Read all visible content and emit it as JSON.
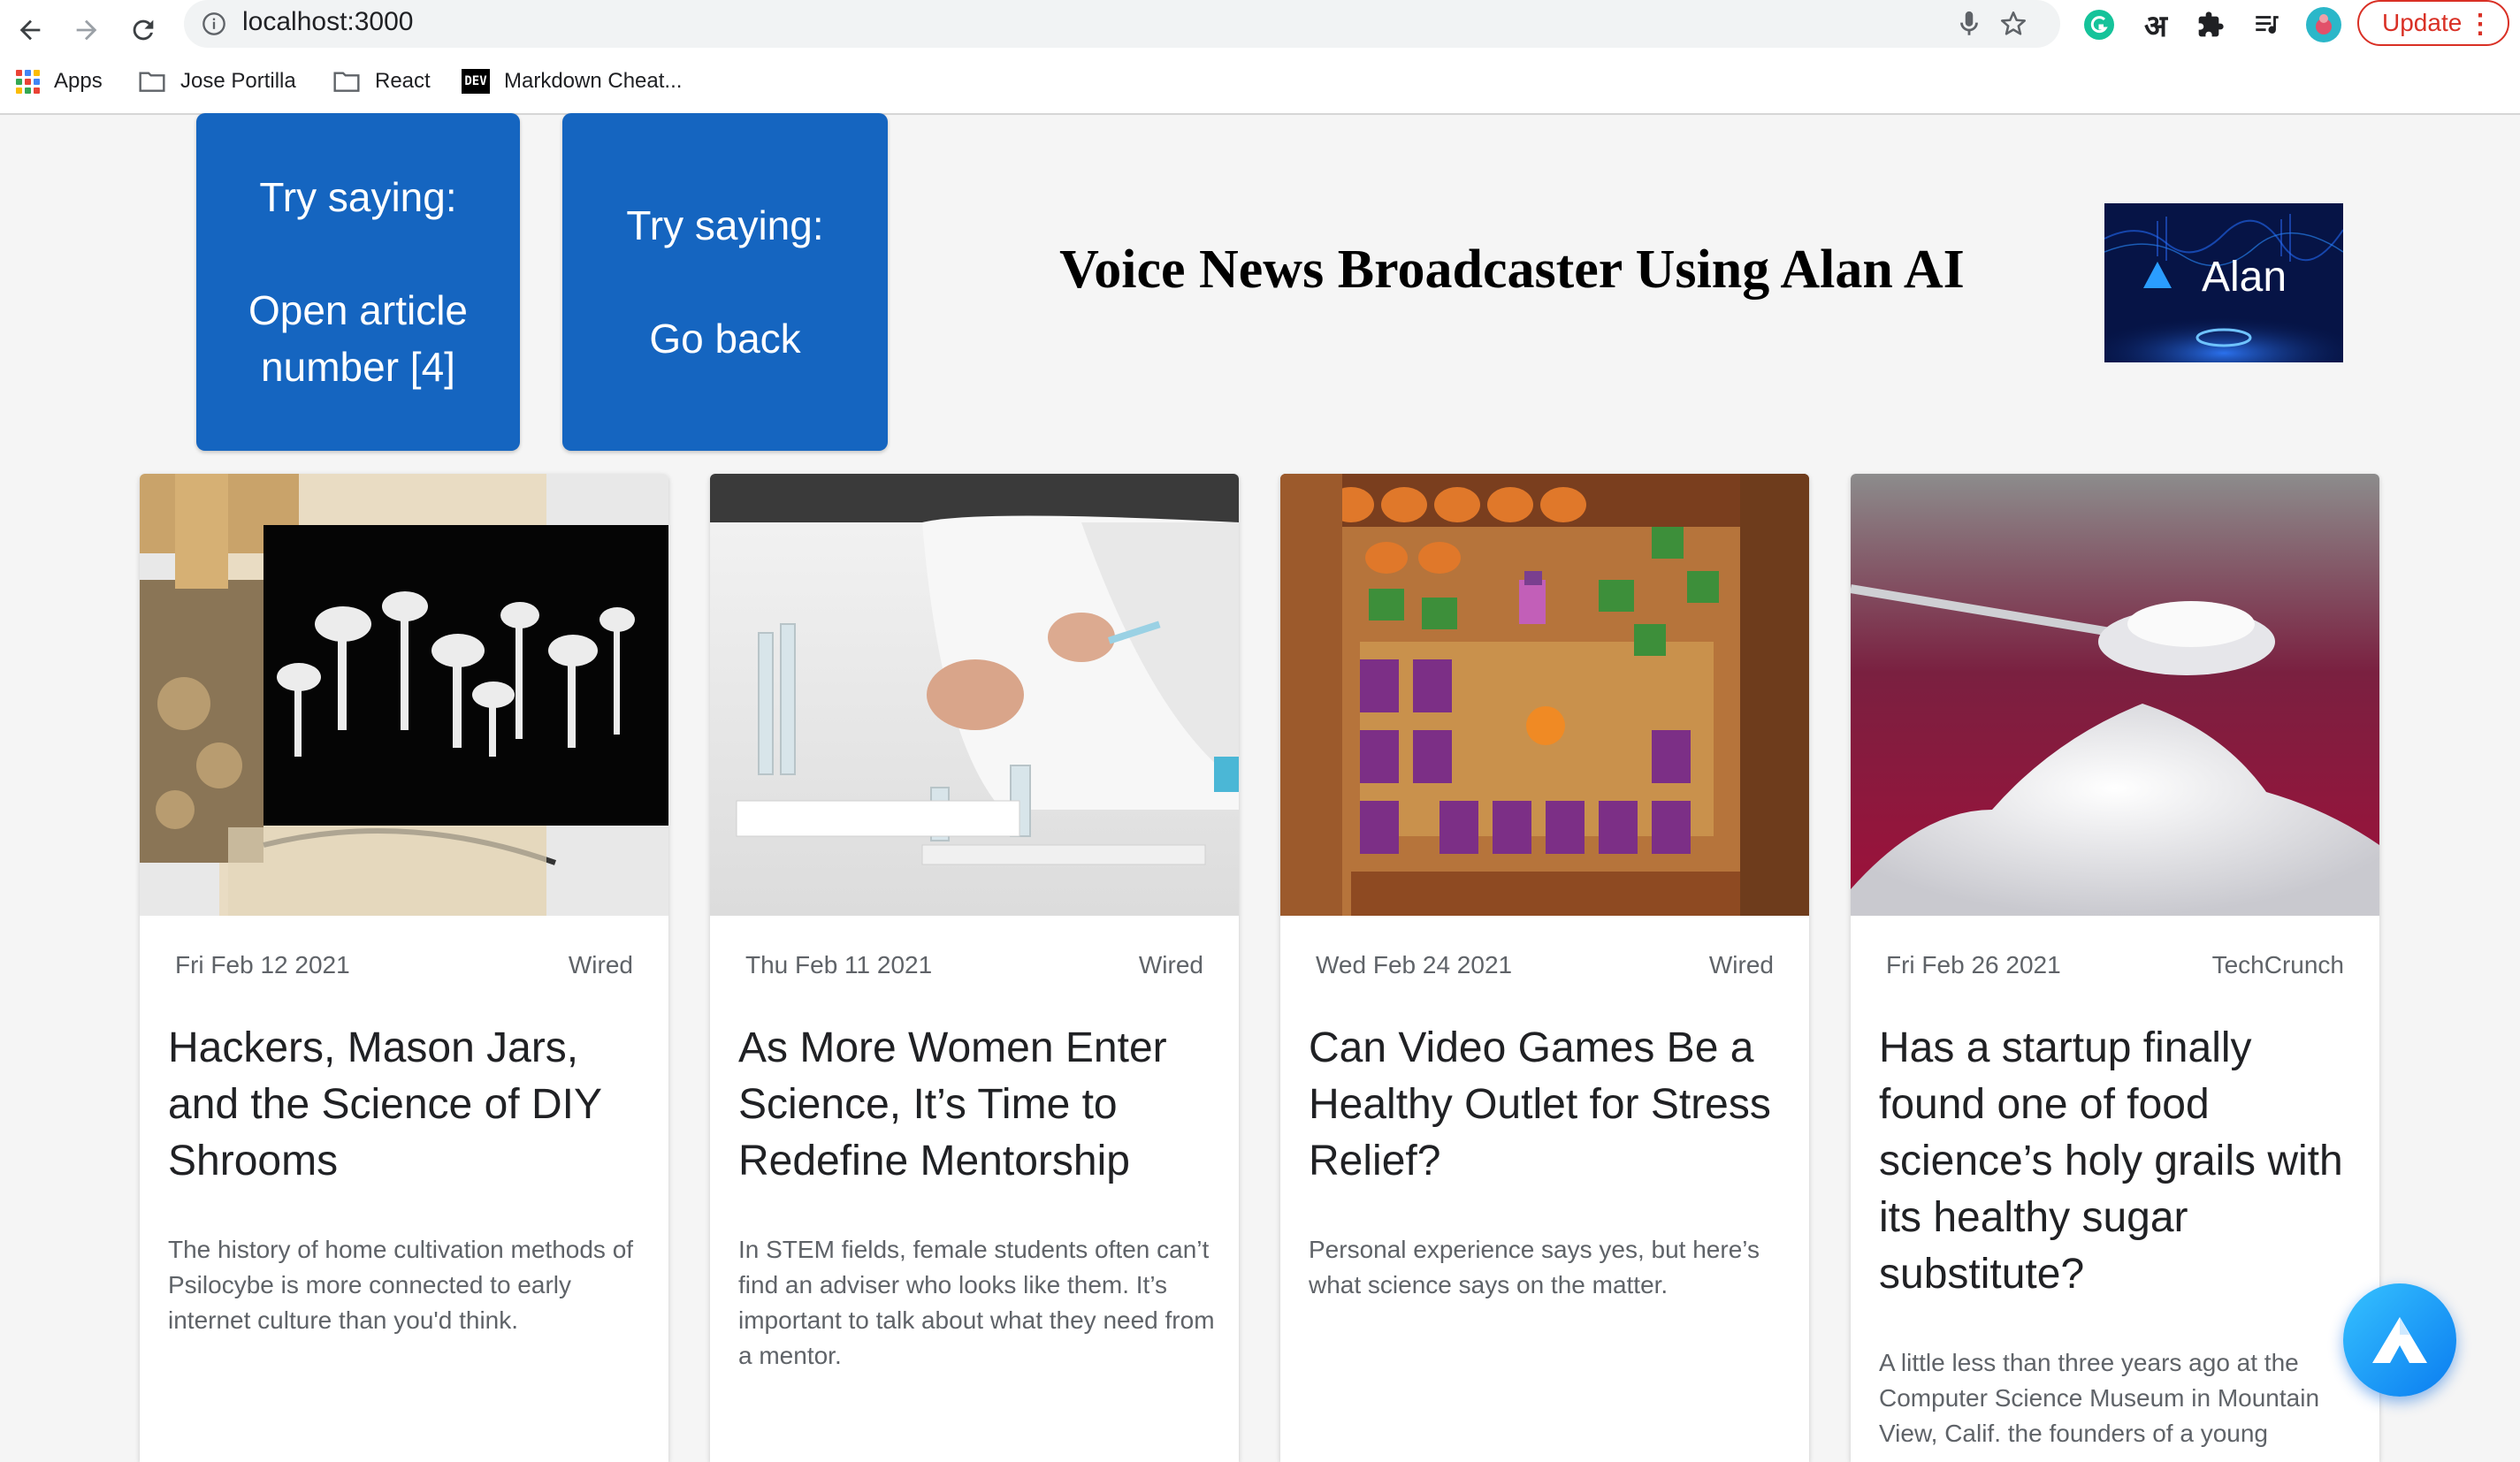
{
  "browser": {
    "url": "localhost:3000",
    "update_label": "Update",
    "bookmarks": [
      {
        "label": "Apps",
        "icon": "apps-grid-icon"
      },
      {
        "label": "Jose Portilla",
        "icon": "folder-icon"
      },
      {
        "label": "React",
        "icon": "folder-icon"
      },
      {
        "label": "Markdown Cheat...",
        "icon": "dev-logo-icon"
      }
    ],
    "dev_logo_text": "DEV",
    "hindi_ext_text": "अ"
  },
  "hints": [
    {
      "line1": "Try saying:",
      "line2": "Open article",
      "line3": "number [4]"
    },
    {
      "line1": "Try saying:",
      "line2": "Go back"
    }
  ],
  "header": {
    "title": "Voice News Broadcaster Using Alan AI",
    "logo_text": "Alan"
  },
  "articles": [
    {
      "date": "Fri Feb 12 2021",
      "source": "Wired",
      "title": "Hackers, Mason Jars, and the Science of DIY Shrooms",
      "description": "The history of home cultivation methods of Psilocybe is more connected to early internet culture than you'd think.",
      "image": "mushroom-collage-image"
    },
    {
      "date": "Thu Feb 11 2021",
      "source": "Wired",
      "title": "As More Women Enter Science, It’s Time to Redefine Mentorship",
      "description": "In STEM fields, female students often can’t find an adviser who looks like them. It’s important to talk about what they need from a mentor.",
      "image": "lab-scientist-image"
    },
    {
      "date": "Wed Feb 24 2021",
      "source": "Wired",
      "title": "Can Video Games Be a Healthy Outlet for Stress Relief?",
      "description": "Personal experience says yes, but here’s what science says on the matter.",
      "image": "pixel-farm-game-image"
    },
    {
      "date": "Fri Feb 26 2021",
      "source": "TechCrunch",
      "title": "Has a startup finally found one of food science’s holy grails with its healthy sugar substitute?",
      "description": "A little less than three years ago at the Computer Science Museum in Mountain View, Calif. the founders of a young",
      "image": "sugar-spoon-image"
    }
  ],
  "colors": {
    "hint_card": "#1565c0",
    "page_bg": "#f5f5f5",
    "update_red": "#d93025",
    "alan_fab": "#1e9bf5"
  }
}
